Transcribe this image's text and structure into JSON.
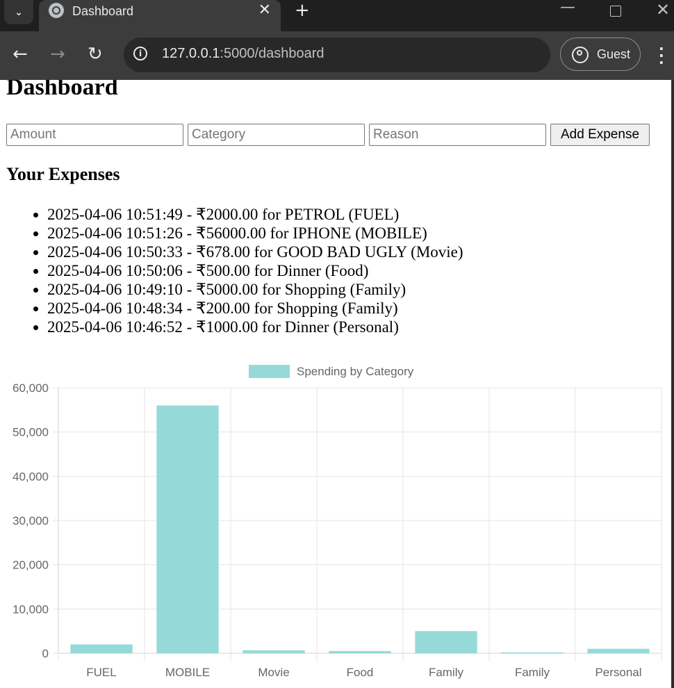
{
  "browser": {
    "tab_title": "Dashboard",
    "url_host": "127.0.0.1",
    "url_path": ":5000/dashboard",
    "profile_label": "Guest"
  },
  "page": {
    "title": "Dashboard",
    "form": {
      "amount_placeholder": "Amount",
      "category_placeholder": "Category",
      "reason_placeholder": "Reason",
      "submit_label": "Add Expense"
    },
    "expenses_heading": "Your Expenses",
    "expenses": [
      "2025-04-06 10:51:49 - ₹2000.00 for PETROL (FUEL)",
      "2025-04-06 10:51:26 - ₹56000.00 for IPHONE (MOBILE)",
      "2025-04-06 10:50:33 - ₹678.00 for GOOD BAD UGLY (Movie)",
      "2025-04-06 10:50:06 - ₹500.00 for Dinner (Food)",
      "2025-04-06 10:49:10 - ₹5000.00 for Shopping (Family)",
      "2025-04-06 10:48:34 - ₹200.00 for Shopping (Family)",
      "2025-04-06 10:46:52 - ₹1000.00 for Dinner (Personal)"
    ]
  },
  "chart_data": {
    "type": "bar",
    "title": "",
    "categories": [
      "FUEL",
      "MOBILE",
      "Movie",
      "Food",
      "Family",
      "Family",
      "Personal"
    ],
    "series": [
      {
        "name": "Spending by Category",
        "values": [
          2000,
          56000,
          678,
          500,
          5000,
          200,
          1000
        ]
      }
    ],
    "ylim": [
      0,
      60000
    ],
    "yticks": [
      "0",
      "10,000",
      "20,000",
      "30,000",
      "40,000",
      "50,000",
      "60,000"
    ],
    "grid": true,
    "legend_position": "top",
    "bar_color": "#96d9d9"
  }
}
